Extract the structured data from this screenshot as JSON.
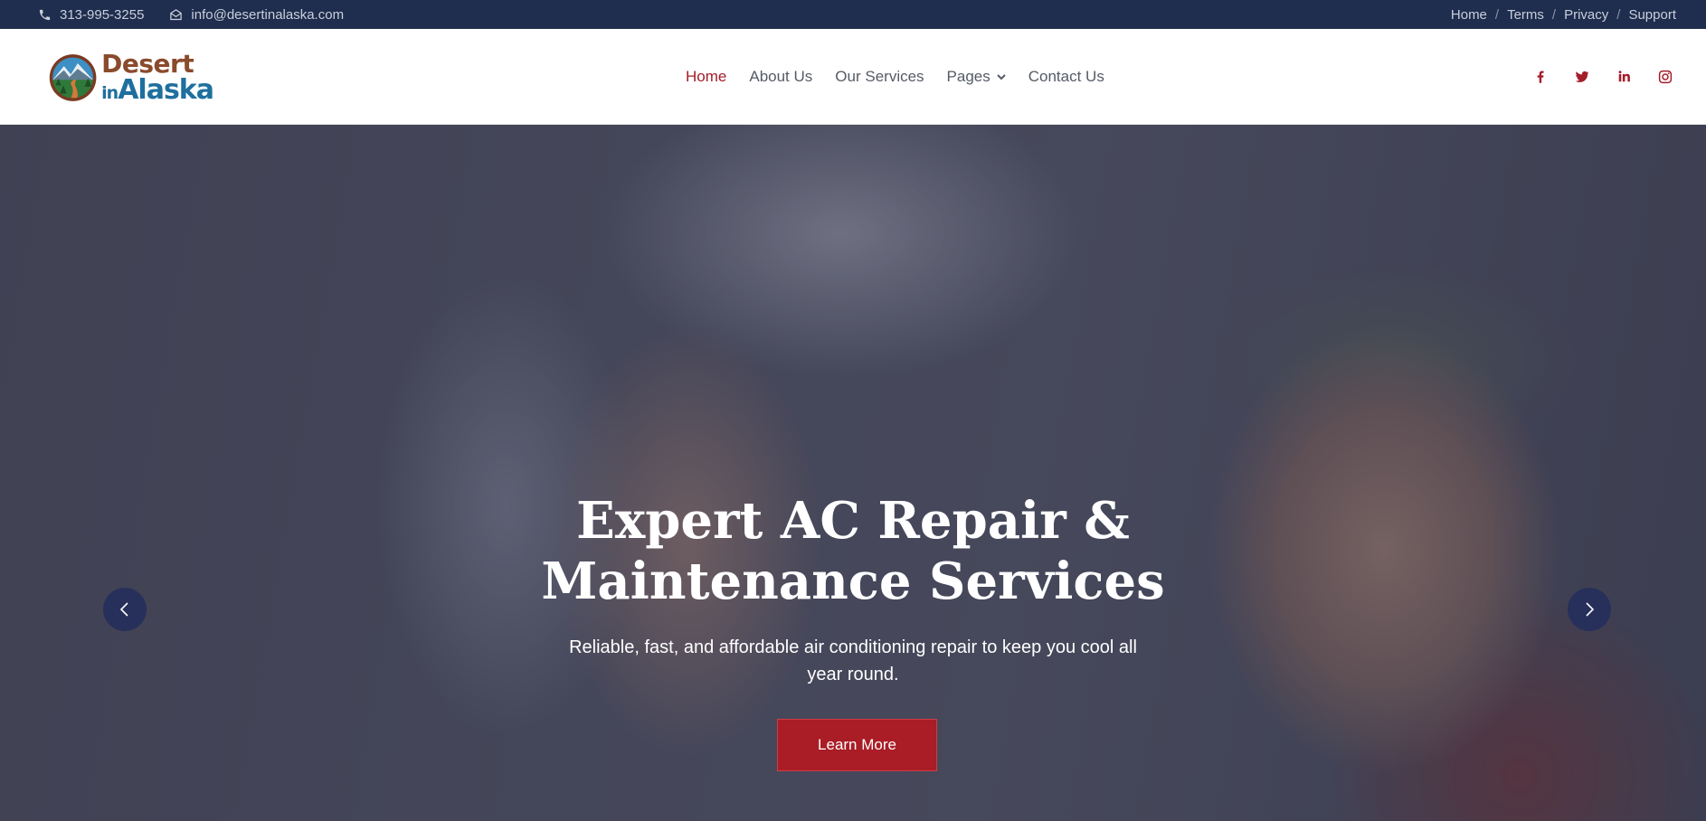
{
  "topbar": {
    "phone": "313-995-3255",
    "email": "info@desertinalaska.com",
    "links": [
      "Home",
      "Terms",
      "Privacy",
      "Support"
    ],
    "separator": "/"
  },
  "logo": {
    "line1": "Desert",
    "line2_small": "in",
    "line2": "Alaska"
  },
  "nav": {
    "items": [
      {
        "label": "Home",
        "active": true
      },
      {
        "label": "About Us",
        "active": false
      },
      {
        "label": "Our Services",
        "active": false
      },
      {
        "label": "Pages",
        "active": false,
        "dropdown": true
      },
      {
        "label": "Contact Us",
        "active": false
      }
    ]
  },
  "social": [
    "facebook-icon",
    "twitter-icon",
    "linkedin-icon",
    "instagram-icon"
  ],
  "hero": {
    "title_line1": "Expert AC Repair &",
    "title_line2": "Maintenance Services",
    "subtitle_line1": "Reliable, fast, and affordable air conditioning repair to keep you cool all",
    "subtitle_line2": "year round.",
    "button_label": "Learn More"
  },
  "colors": {
    "topbar_bg": "#1f2d4e",
    "accent": "#a31d2a",
    "button": "#aa1c26",
    "arrow_bg": "#27305a",
    "logo_brown": "#8a4b2c",
    "logo_blue": "#1f6f9e"
  }
}
